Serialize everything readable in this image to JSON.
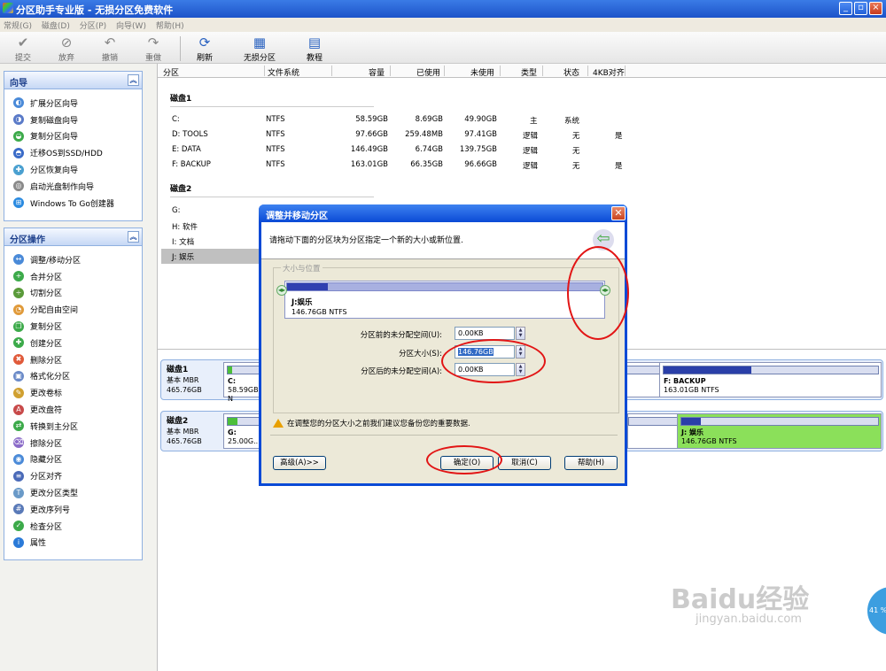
{
  "window": {
    "title": "分区助手专业版 - 无损分区免费软件",
    "minimize": "_",
    "restore": "▫",
    "close": "×"
  },
  "menu": [
    "常规(G)",
    "磁盘(D)",
    "分区(P)",
    "向导(W)",
    "帮助(H)"
  ],
  "toolbar": {
    "commit": "提交",
    "discard": "放弃",
    "undo": "撤销",
    "redo": "重做",
    "refresh": "刷新",
    "nondestructive": "无损分区",
    "tutorial": "教程"
  },
  "wizard_panel": {
    "title": "向导",
    "items": [
      "扩展分区向导",
      "复制磁盘向导",
      "复制分区向导",
      "迁移OS到SSD/HDD",
      "分区恢复向导",
      "启动光盘制作向导",
      "Windows To Go创建器"
    ]
  },
  "partition_panel": {
    "title": "分区操作",
    "items": [
      "调整/移动分区",
      "合并分区",
      "切割分区",
      "分配自由空间",
      "复制分区",
      "创建分区",
      "删除分区",
      "格式化分区",
      "更改卷标",
      "更改盘符",
      "转换到主分区",
      "擦除分区",
      "隐藏分区",
      "分区对齐",
      "更改分区类型",
      "更改序列号",
      "检查分区",
      "属性"
    ]
  },
  "columns": [
    "分区",
    "文件系统",
    "容量",
    "已使用",
    "未使用",
    "类型",
    "状态",
    "4KB对齐"
  ],
  "disk1": {
    "label": "磁盘1",
    "rows": [
      {
        "name": "C:",
        "fs": "NTFS",
        "cap": "58.59GB",
        "used": "8.69GB",
        "free": "49.90GB",
        "type": "主",
        "status": "系统",
        "align": ""
      },
      {
        "name": "D: TOOLS",
        "fs": "NTFS",
        "cap": "97.66GB",
        "used": "259.48MB",
        "free": "97.41GB",
        "type": "逻辑",
        "status": "无",
        "align": "是"
      },
      {
        "name": "E: DATA",
        "fs": "NTFS",
        "cap": "146.49GB",
        "used": "6.74GB",
        "free": "139.75GB",
        "type": "逻辑",
        "status": "无",
        "align": ""
      },
      {
        "name": "F: BACKUP",
        "fs": "NTFS",
        "cap": "163.01GB",
        "used": "66.35GB",
        "free": "96.66GB",
        "type": "逻辑",
        "status": "无",
        "align": "是"
      }
    ]
  },
  "disk2": {
    "label": "磁盘2",
    "rows": [
      {
        "name": "G:"
      },
      {
        "name": "H: 软件"
      },
      {
        "name": "I: 文档"
      },
      {
        "name": "J: 娱乐"
      }
    ]
  },
  "disk_cards": {
    "disk1": {
      "name": "磁盘1",
      "kind": "基本 MBR",
      "size": "465.76GB",
      "p1_name": "C:",
      "p1_size": "58.59GB N",
      "p1_used": 0.15,
      "plast_name": "F: BACKUP",
      "plast_size": "163.01GB NTFS",
      "plast_used": 0.41
    },
    "disk2": {
      "name": "磁盘2",
      "kind": "基本 MBR",
      "size": "465.76GB",
      "p1_name": "G:",
      "p1_size": "25.00G...",
      "p1_used": 0.3,
      "plast_name": "J: 娱乐",
      "plast_size": "146.76GB NTFS",
      "plast_used": 0.1
    }
  },
  "dialog": {
    "title": "调整并移动分区",
    "instruction": "请拖动下面的分区块为分区指定一个新的大小或新位置.",
    "group_label": "大小与位置",
    "partition_name": "J:娱乐",
    "partition_size": "146.76GB NTFS",
    "used_fraction": 0.13,
    "before_label": "分区前的未分配空间(U):",
    "before_value": "0.00KB",
    "size_label": "分区大小(S):",
    "size_value": "146.76GB",
    "after_label": "分区后的未分配空间(A):",
    "after_value": "0.00KB",
    "warning": "在调整您的分区大小之前我们建议您备份您的重要数据.",
    "advanced": "高级(A)>>",
    "ok": "确定(O)",
    "cancel": "取消(C)",
    "help": "帮助(H)"
  },
  "watermark": {
    "brand": "Baidu经验",
    "url": "jingyan.baidu.com",
    "percent": "41 %"
  },
  "colors": {
    "accent": "#0a4ad6",
    "annotation": "#e21515",
    "selected_partition": "#8be05a"
  }
}
